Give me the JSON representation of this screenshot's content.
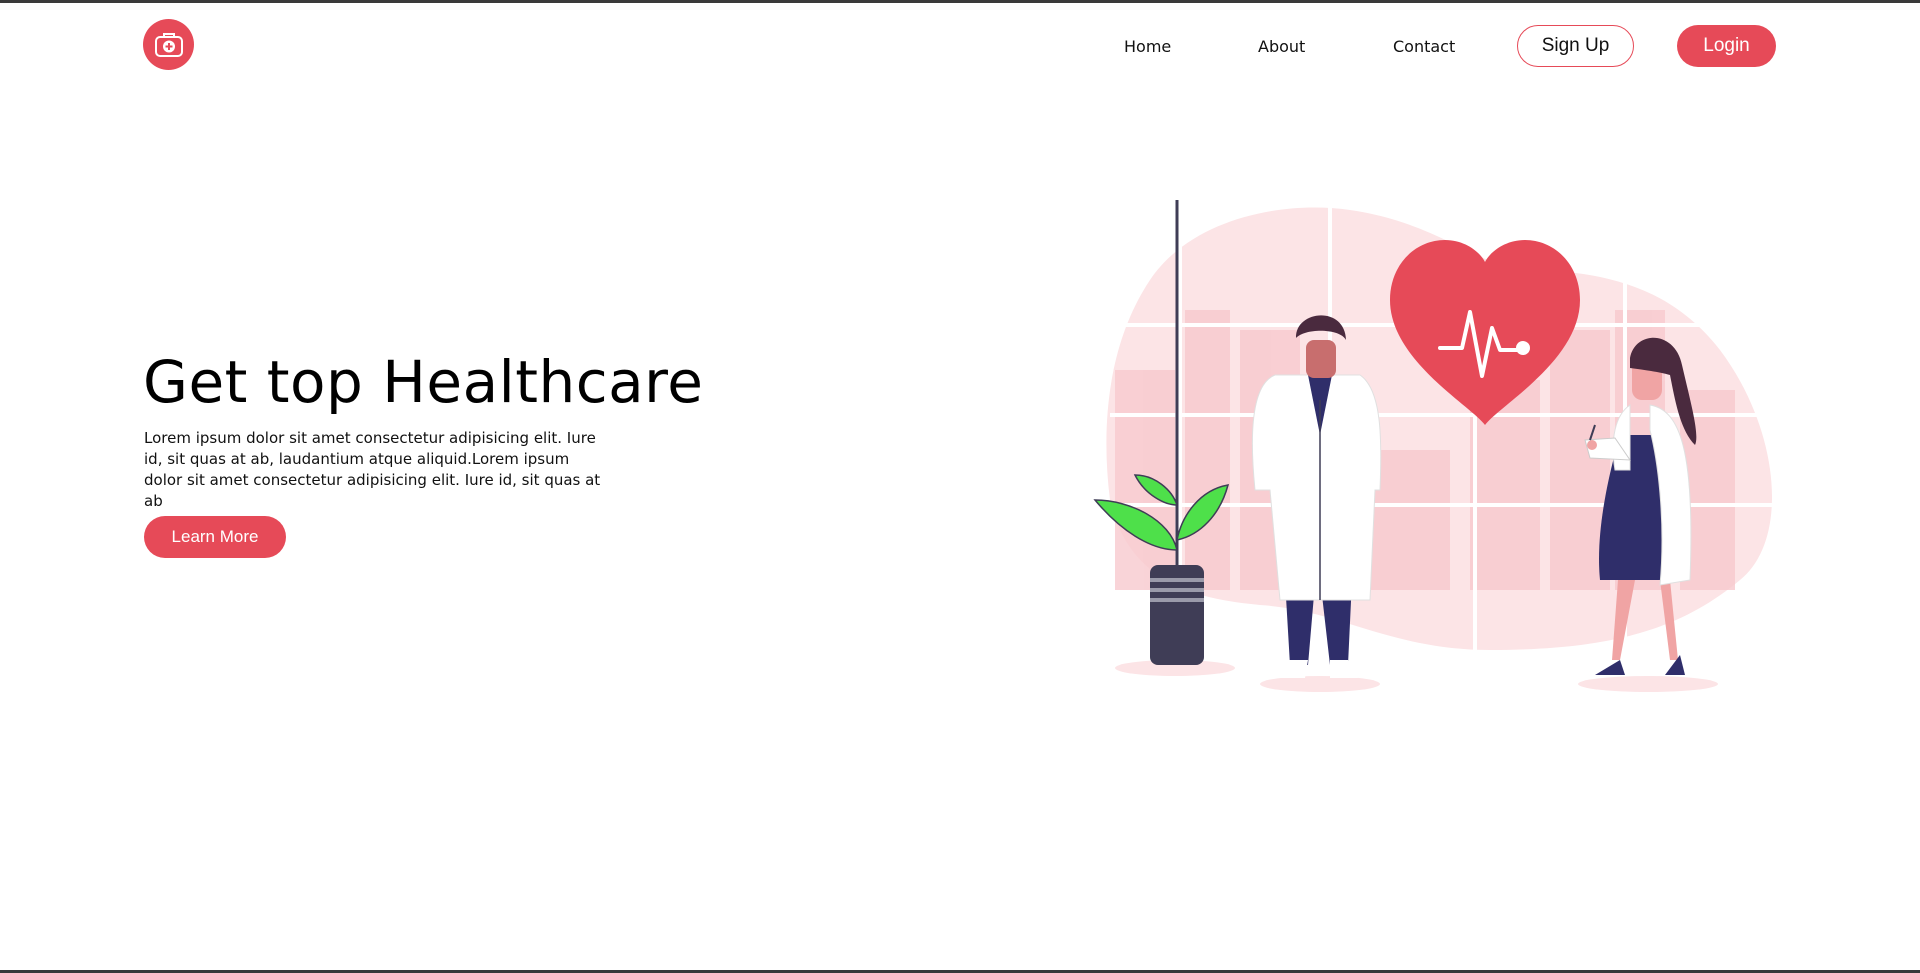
{
  "nav": {
    "links": [
      "Home",
      "About",
      "Contact"
    ],
    "signup_label": "Sign Up",
    "login_label": "Login",
    "logo_icon": "medical-kit-icon"
  },
  "hero": {
    "title": "Get top Healthcare",
    "description": "Lorem ipsum dolor sit amet consectetur adipisicing elit. Iure id, sit quas at ab, laudantium atque aliquid.Lorem ipsum dolor sit amet consectetur adipisicing elit. Iure id, sit quas at ab",
    "cta_label": "Learn More"
  },
  "illustration": {
    "name": "doctors-heartbeat-illustration"
  },
  "colors": {
    "accent": "#e64a58",
    "blob": "#fce4e6",
    "plant_leaf": "#4ee04a",
    "pot": "#3f3d56",
    "scrubs": "#2f2e6a"
  }
}
